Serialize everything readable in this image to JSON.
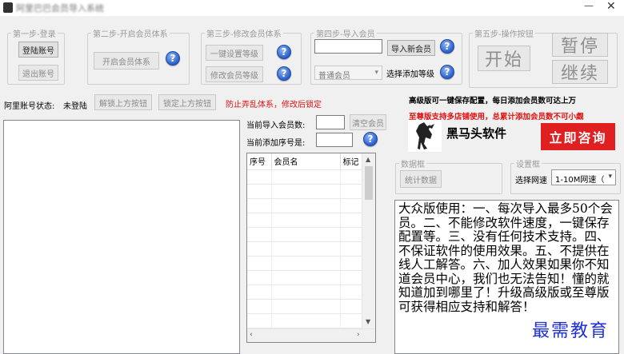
{
  "window": {
    "title": "阿里巴巴会员导入系统",
    "minimize": "—",
    "close": "✕"
  },
  "step1": {
    "legend": "第一步-登录",
    "login": "登陆账号",
    "logout": "退出账号"
  },
  "step2": {
    "legend": "第二步-开启会员体系",
    "open": "开启会员体系"
  },
  "step3": {
    "legend": "第三步-修改会员体系",
    "one_click": "一键设置等级",
    "modify": "修改会员等级"
  },
  "step4": {
    "legend": "第四步-导入会员",
    "import_button": "导入新会员",
    "level_select": "普通会员",
    "choose_level_label": "选择添加等级"
  },
  "step5": {
    "legend": "第五步-操作按钮",
    "start": "开始",
    "pause": "暂停",
    "resume": "继续"
  },
  "help_glyph": "?",
  "status": {
    "label": "阿里账号状态:",
    "value": "未登陆",
    "unlock": "解锁上方按钮",
    "lock": "锁定上方按钮",
    "warning": "防止弄乱体系，修改后锁定"
  },
  "promo": {
    "line1": "高级版可一键保存配置，每日添加会员数可达上万",
    "line2": "至尊版支持多店铺使用，总累计添加会员数不可小觑"
  },
  "counters": {
    "imported_label": "当前导入会员数:",
    "clear": "清空会员",
    "seq_label": "当前添加序号是:"
  },
  "table": {
    "columns": [
      "序号",
      "会员名",
      "标记"
    ]
  },
  "brand": {
    "name": "黑马头软件",
    "consult": "立即咨询"
  },
  "data_box": {
    "legend": "数据框",
    "stats": "统计数据"
  },
  "settings_box": {
    "legend": "设置框",
    "speed_label": "选择网速",
    "speed_value": "1-10M网速（"
  },
  "notice": "大众版使用：一、每次导入最多50个会员。二、不能修改软件速度，一键保存配置等。三、没有任何技术支持。四、不保证软件的使用效果。五、不提供在线人工解答。六、加人效果如果你不知道会员中心，我们也无法告知！懂的就知道加到哪里了！升级高级版或至尊版可获得相应支持和解答！",
  "watermark": "最需教育",
  "colors": {
    "warning": "#e01010",
    "promo_red": "#e01010",
    "consult_bg": "#e02020",
    "help_blue": "#2a5fc8",
    "watermark": "#1e2fd6"
  }
}
